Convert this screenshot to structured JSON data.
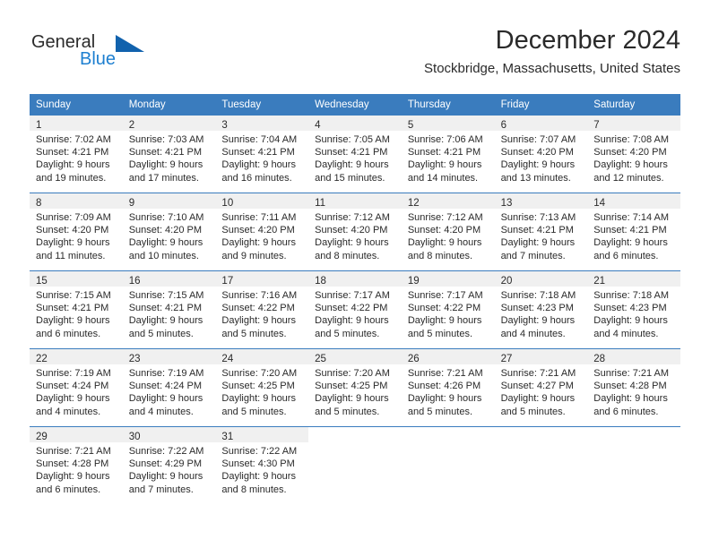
{
  "brand": {
    "name_top": "General",
    "name_bottom": "Blue",
    "triangle_icon": "triangle-icon",
    "color_dark": "#2b2b2b",
    "color_blue": "#1d7fd0",
    "color_triangle": "#1162ad"
  },
  "header": {
    "title": "December 2024",
    "subtitle": "Stockbridge, Massachusetts, United States"
  },
  "theme": {
    "header_row_bg": "#3a7cbe",
    "header_row_text": "#ffffff",
    "day_band_bg": "#f0f0f0",
    "text": "#2a2a2a"
  },
  "weekdays": [
    "Sunday",
    "Monday",
    "Tuesday",
    "Wednesday",
    "Thursday",
    "Friday",
    "Saturday"
  ],
  "weeks": [
    [
      {
        "day": "1",
        "lines": [
          "Sunrise: 7:02 AM",
          "Sunset: 4:21 PM",
          "Daylight: 9 hours",
          "and 19 minutes."
        ]
      },
      {
        "day": "2",
        "lines": [
          "Sunrise: 7:03 AM",
          "Sunset: 4:21 PM",
          "Daylight: 9 hours",
          "and 17 minutes."
        ]
      },
      {
        "day": "3",
        "lines": [
          "Sunrise: 7:04 AM",
          "Sunset: 4:21 PM",
          "Daylight: 9 hours",
          "and 16 minutes."
        ]
      },
      {
        "day": "4",
        "lines": [
          "Sunrise: 7:05 AM",
          "Sunset: 4:21 PM",
          "Daylight: 9 hours",
          "and 15 minutes."
        ]
      },
      {
        "day": "5",
        "lines": [
          "Sunrise: 7:06 AM",
          "Sunset: 4:21 PM",
          "Daylight: 9 hours",
          "and 14 minutes."
        ]
      },
      {
        "day": "6",
        "lines": [
          "Sunrise: 7:07 AM",
          "Sunset: 4:20 PM",
          "Daylight: 9 hours",
          "and 13 minutes."
        ]
      },
      {
        "day": "7",
        "lines": [
          "Sunrise: 7:08 AM",
          "Sunset: 4:20 PM",
          "Daylight: 9 hours",
          "and 12 minutes."
        ]
      }
    ],
    [
      {
        "day": "8",
        "lines": [
          "Sunrise: 7:09 AM",
          "Sunset: 4:20 PM",
          "Daylight: 9 hours",
          "and 11 minutes."
        ]
      },
      {
        "day": "9",
        "lines": [
          "Sunrise: 7:10 AM",
          "Sunset: 4:20 PM",
          "Daylight: 9 hours",
          "and 10 minutes."
        ]
      },
      {
        "day": "10",
        "lines": [
          "Sunrise: 7:11 AM",
          "Sunset: 4:20 PM",
          "Daylight: 9 hours",
          "and 9 minutes."
        ]
      },
      {
        "day": "11",
        "lines": [
          "Sunrise: 7:12 AM",
          "Sunset: 4:20 PM",
          "Daylight: 9 hours",
          "and 8 minutes."
        ]
      },
      {
        "day": "12",
        "lines": [
          "Sunrise: 7:12 AM",
          "Sunset: 4:20 PM",
          "Daylight: 9 hours",
          "and 8 minutes."
        ]
      },
      {
        "day": "13",
        "lines": [
          "Sunrise: 7:13 AM",
          "Sunset: 4:21 PM",
          "Daylight: 9 hours",
          "and 7 minutes."
        ]
      },
      {
        "day": "14",
        "lines": [
          "Sunrise: 7:14 AM",
          "Sunset: 4:21 PM",
          "Daylight: 9 hours",
          "and 6 minutes."
        ]
      }
    ],
    [
      {
        "day": "15",
        "lines": [
          "Sunrise: 7:15 AM",
          "Sunset: 4:21 PM",
          "Daylight: 9 hours",
          "and 6 minutes."
        ]
      },
      {
        "day": "16",
        "lines": [
          "Sunrise: 7:15 AM",
          "Sunset: 4:21 PM",
          "Daylight: 9 hours",
          "and 5 minutes."
        ]
      },
      {
        "day": "17",
        "lines": [
          "Sunrise: 7:16 AM",
          "Sunset: 4:22 PM",
          "Daylight: 9 hours",
          "and 5 minutes."
        ]
      },
      {
        "day": "18",
        "lines": [
          "Sunrise: 7:17 AM",
          "Sunset: 4:22 PM",
          "Daylight: 9 hours",
          "and 5 minutes."
        ]
      },
      {
        "day": "19",
        "lines": [
          "Sunrise: 7:17 AM",
          "Sunset: 4:22 PM",
          "Daylight: 9 hours",
          "and 5 minutes."
        ]
      },
      {
        "day": "20",
        "lines": [
          "Sunrise: 7:18 AM",
          "Sunset: 4:23 PM",
          "Daylight: 9 hours",
          "and 4 minutes."
        ]
      },
      {
        "day": "21",
        "lines": [
          "Sunrise: 7:18 AM",
          "Sunset: 4:23 PM",
          "Daylight: 9 hours",
          "and 4 minutes."
        ]
      }
    ],
    [
      {
        "day": "22",
        "lines": [
          "Sunrise: 7:19 AM",
          "Sunset: 4:24 PM",
          "Daylight: 9 hours",
          "and 4 minutes."
        ]
      },
      {
        "day": "23",
        "lines": [
          "Sunrise: 7:19 AM",
          "Sunset: 4:24 PM",
          "Daylight: 9 hours",
          "and 4 minutes."
        ]
      },
      {
        "day": "24",
        "lines": [
          "Sunrise: 7:20 AM",
          "Sunset: 4:25 PM",
          "Daylight: 9 hours",
          "and 5 minutes."
        ]
      },
      {
        "day": "25",
        "lines": [
          "Sunrise: 7:20 AM",
          "Sunset: 4:25 PM",
          "Daylight: 9 hours",
          "and 5 minutes."
        ]
      },
      {
        "day": "26",
        "lines": [
          "Sunrise: 7:21 AM",
          "Sunset: 4:26 PM",
          "Daylight: 9 hours",
          "and 5 minutes."
        ]
      },
      {
        "day": "27",
        "lines": [
          "Sunrise: 7:21 AM",
          "Sunset: 4:27 PM",
          "Daylight: 9 hours",
          "and 5 minutes."
        ]
      },
      {
        "day": "28",
        "lines": [
          "Sunrise: 7:21 AM",
          "Sunset: 4:28 PM",
          "Daylight: 9 hours",
          "and 6 minutes."
        ]
      }
    ],
    [
      {
        "day": "29",
        "lines": [
          "Sunrise: 7:21 AM",
          "Sunset: 4:28 PM",
          "Daylight: 9 hours",
          "and 6 minutes."
        ]
      },
      {
        "day": "30",
        "lines": [
          "Sunrise: 7:22 AM",
          "Sunset: 4:29 PM",
          "Daylight: 9 hours",
          "and 7 minutes."
        ]
      },
      {
        "day": "31",
        "lines": [
          "Sunrise: 7:22 AM",
          "Sunset: 4:30 PM",
          "Daylight: 9 hours",
          "and 8 minutes."
        ]
      },
      {
        "day": "",
        "lines": []
      },
      {
        "day": "",
        "lines": []
      },
      {
        "day": "",
        "lines": []
      },
      {
        "day": "",
        "lines": []
      }
    ]
  ]
}
